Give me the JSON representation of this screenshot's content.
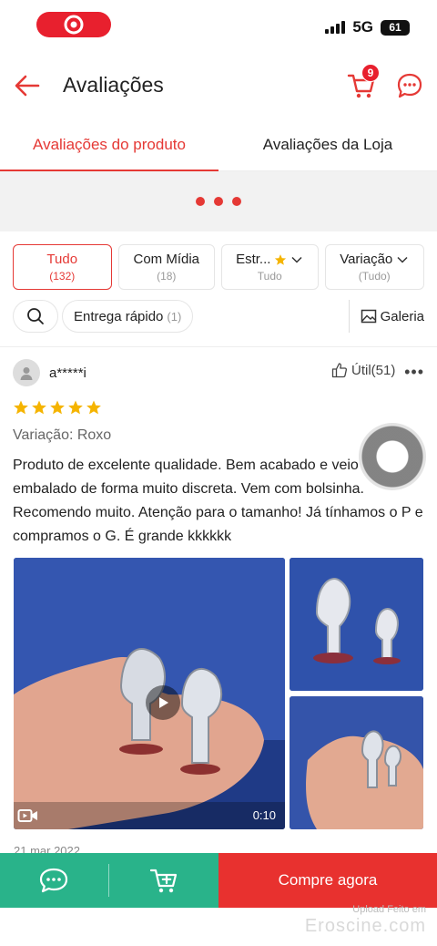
{
  "status_bar": {
    "network": "5G",
    "battery": "61"
  },
  "header": {
    "title": "Avaliações",
    "cart_count": "9"
  },
  "tabs": [
    {
      "label": "Avaliações do produto"
    },
    {
      "label": "Avaliações da Loja"
    }
  ],
  "filters": [
    {
      "label": "Tudo",
      "sub": "(132)"
    },
    {
      "label": "Com Mídia",
      "sub": "(18)"
    },
    {
      "label": "Estr...",
      "sub": "Tudo"
    },
    {
      "label": "Variação",
      "sub": "(Tudo)"
    }
  ],
  "quick_filter": {
    "label": "Entrega rápido",
    "count": "(1)"
  },
  "gallery_label": "Galeria",
  "review": {
    "user": "a*****i",
    "helpful": "Útil(51)",
    "rating": 5,
    "variation": "Variação: Roxo",
    "text": "Produto de excelente qualidade. Bem acabado e veio embalado de forma muito discreta. Vem com bolsinha. Recomendo muito. Atenção para o tamanho! Já tínhamos o P e compramos o G. É grande kkkkkk",
    "video_duration": "0:10",
    "date": "21 mar 2022"
  },
  "bottom_bar": {
    "buy_label": "Compre agora"
  },
  "watermark": {
    "line1": "Upload Feito em",
    "line2": "Eroscine.com"
  },
  "colors": {
    "accent": "#e53935",
    "buy": "#e8312f",
    "secondary": "#29b38a",
    "star": "#f5b400"
  }
}
